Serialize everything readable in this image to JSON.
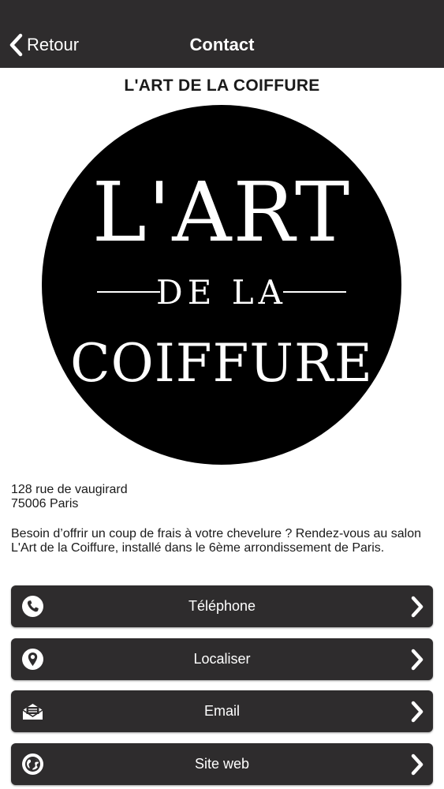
{
  "navbar": {
    "back_label": "Retour",
    "title": "Contact"
  },
  "salon": {
    "name": "L'ART DE LA COIFFURE",
    "logo_text": {
      "line1": "L'ART",
      "line2": "DE LA",
      "line3": "COIFFURE"
    },
    "address_line1": "128 rue de vaugirard",
    "address_line2": "75006 Paris",
    "description": "Besoin d’offrir un coup de frais à votre chevelure ? Rendez-vous au salon L'Art de la Coiffure, installé dans le 6ème arrondissement de Paris."
  },
  "actions": {
    "phone_label": "Téléphone",
    "locate_label": "Localiser",
    "email_label": "Email",
    "web_label": "Site web"
  },
  "colors": {
    "navbar_bg": "#2e2c2d",
    "button_bg": "#2e2c2d",
    "text": "#1a1a1a",
    "logo_bg": "#000000"
  },
  "icons": {
    "back": "chevron-left-icon",
    "phone": "phone-icon",
    "locate": "map-pin-icon",
    "email": "envelope-icon",
    "web": "globe-icon",
    "chevron": "chevron-right-icon"
  }
}
